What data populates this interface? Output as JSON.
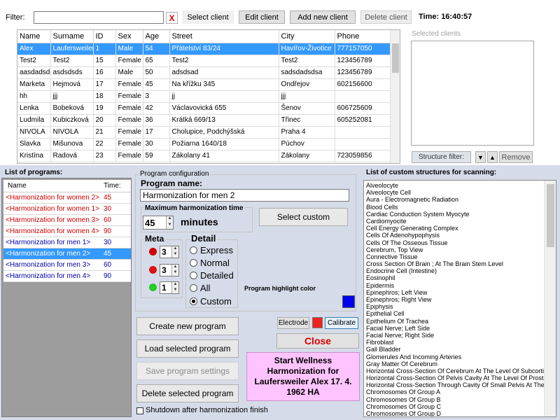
{
  "topbar": {
    "filter_label": "Filter:",
    "filter_value": "",
    "clear_label": "X",
    "select_client": "Select client",
    "edit_client": "Edit client",
    "add_client": "Add new client",
    "delete_client": "Delete client",
    "time_label": "Time: 16:40:57"
  },
  "clients": {
    "columns": [
      "Name",
      "Surname",
      "ID",
      "Sex",
      "Age",
      "Street",
      "City",
      "Phone"
    ],
    "rows": [
      [
        "Alex",
        "Laufersweiler",
        "1",
        "Male",
        "54",
        "Přátelství 83/24",
        "Havířov-Životice",
        "777157050"
      ],
      [
        "Test2",
        "Test2",
        "15",
        "Female",
        "65",
        "Test2",
        "Test2",
        "123456789"
      ],
      [
        "aasdadsdsa",
        "asdsdsds",
        "16",
        "Male",
        "50",
        "adsdsad",
        "sadsdadsdsa",
        "123456789"
      ],
      [
        "Marketa",
        "Hejmová",
        "17",
        "Female",
        "45",
        "Na křížku 345",
        "Ondřejov",
        "602156600"
      ],
      [
        "hh",
        "jjj",
        "18",
        "Female",
        "3",
        "jj",
        "jjj",
        ""
      ],
      [
        "Lenka",
        "Bobeková",
        "19",
        "Female",
        "42",
        "Václavovická 655",
        "Šenov",
        "606725609"
      ],
      [
        "Ludmila",
        "Kubiczková",
        "20",
        "Female",
        "36",
        "Krátká 669/13",
        "Třinec",
        "605252081"
      ],
      [
        "NIVOLA",
        "NIVOLA",
        "21",
        "Female",
        "17",
        "Cholupice, Podchýšská",
        "Praha 4",
        ""
      ],
      [
        "Slavka",
        "Mišunova",
        "22",
        "Female",
        "30",
        "Požiarna 1640/18",
        "Púchov",
        ""
      ],
      [
        "Kristína",
        "Radová",
        "23",
        "Female",
        "59",
        "Zákolany 41",
        "Zákolany",
        "723059856"
      ]
    ]
  },
  "selected_clients": {
    "label": "Selected clients",
    "structure_filter": "Structure filter:",
    "down": "▼",
    "up": "▲",
    "remove": "Remove"
  },
  "programs": {
    "title": "List of programs:",
    "col_name": "Name",
    "col_time": "Time:",
    "rows": [
      {
        "name": "<Harmonization for women 2>",
        "time": "45",
        "color": "#cc0000"
      },
      {
        "name": "<Harmonization for women 1>",
        "time": "30",
        "color": "#cc0000"
      },
      {
        "name": "<Harmonization for women 3>",
        "time": "60",
        "color": "#cc0000"
      },
      {
        "name": "<Harmonization for women 4>",
        "time": "90",
        "color": "#cc0000"
      },
      {
        "name": "<Harmonization for men 1>",
        "time": "30",
        "color": "#0000aa"
      },
      {
        "name": "<Harmonization for men 2>",
        "time": "45",
        "color": "#0000aa"
      },
      {
        "name": "<Harmonization for men 3>",
        "time": "60",
        "color": "#0000aa"
      },
      {
        "name": "<Harmonization for men 4>",
        "time": "90",
        "color": "#0000aa"
      }
    ]
  },
  "config": {
    "group_title": "Program configuration",
    "program_name_label": "Program name:",
    "program_name_value": "Harmonization for men 2",
    "max_time_label": "Maximum harmonization time",
    "max_time_value": "45",
    "minutes": "minutes",
    "select_custom": "Select custom",
    "meta_label": "Meta",
    "meta_values": [
      "3",
      "3",
      "1"
    ],
    "meta_colors": [
      "#cc0000",
      "#dd1111",
      "#22cc22"
    ],
    "detail_label": "Detail",
    "detail_options": [
      "Express",
      "Normal",
      "Detailed",
      "All",
      "Custom"
    ],
    "highlight_label": "Program highlight color",
    "highlight_color": "#0000ee",
    "electrode": "Electrode",
    "electrode_color": "#ee2222",
    "calibrate": "Calibrate",
    "close": "Close",
    "create": "Create new program",
    "load": "Load selected program",
    "save": "Save program settings",
    "delete": "Delete selected program",
    "shutdown": "Shutdown after harmonization finish",
    "start": "Start Wellness Harmonization for Laufersweiler Alex 17. 4. 1962 HA"
  },
  "structures": {
    "title": "List of custom structures for scanning:",
    "items": [
      "Alveolocyte",
      "Alveolocyte Cell",
      "Aura - Electromagnetic Radiation",
      "Blood Cells",
      "Cardiac Conduction System Myocyte",
      "Cardiomyocite",
      "Cell Energy Generating Complex",
      "Cells Of Adenohypophysis",
      "Cells Of The Osseous Tissue",
      "Cerebrum, Top View",
      "Connective Tissue",
      "Cross Section Of Brain ; At The Brain Stem Level",
      "Endocrine Cell (Intestine)",
      "Eosinophil",
      "Epidermis",
      "Epinephros; Left View",
      "Epinephros; Right View",
      "Epiphysis",
      "Epithelial Cell",
      "Epithelium Of Trachea",
      "Facial Nerve; Left Side",
      "Facial Nerve; Right Side",
      "Fibroblast",
      "Gall Bladder",
      "Glomerules And Incoming Arteries",
      "Gray Matter Of Cerebrum",
      "Horizontal Cross-Section Of Cerebrum At The Level Of Subcortical Nu",
      "Horizontal Cross-Section Of Pelvis Cavity At The Level Of Prostate Gla",
      "Horizontal Cross-Section Through Cavity Of Small Pelvis At The Level",
      "Chromosomes Of Group A",
      "Chromosomes Of Group B",
      "Chromosomes Of Group C",
      "Chromosomes Of Group D"
    ]
  }
}
